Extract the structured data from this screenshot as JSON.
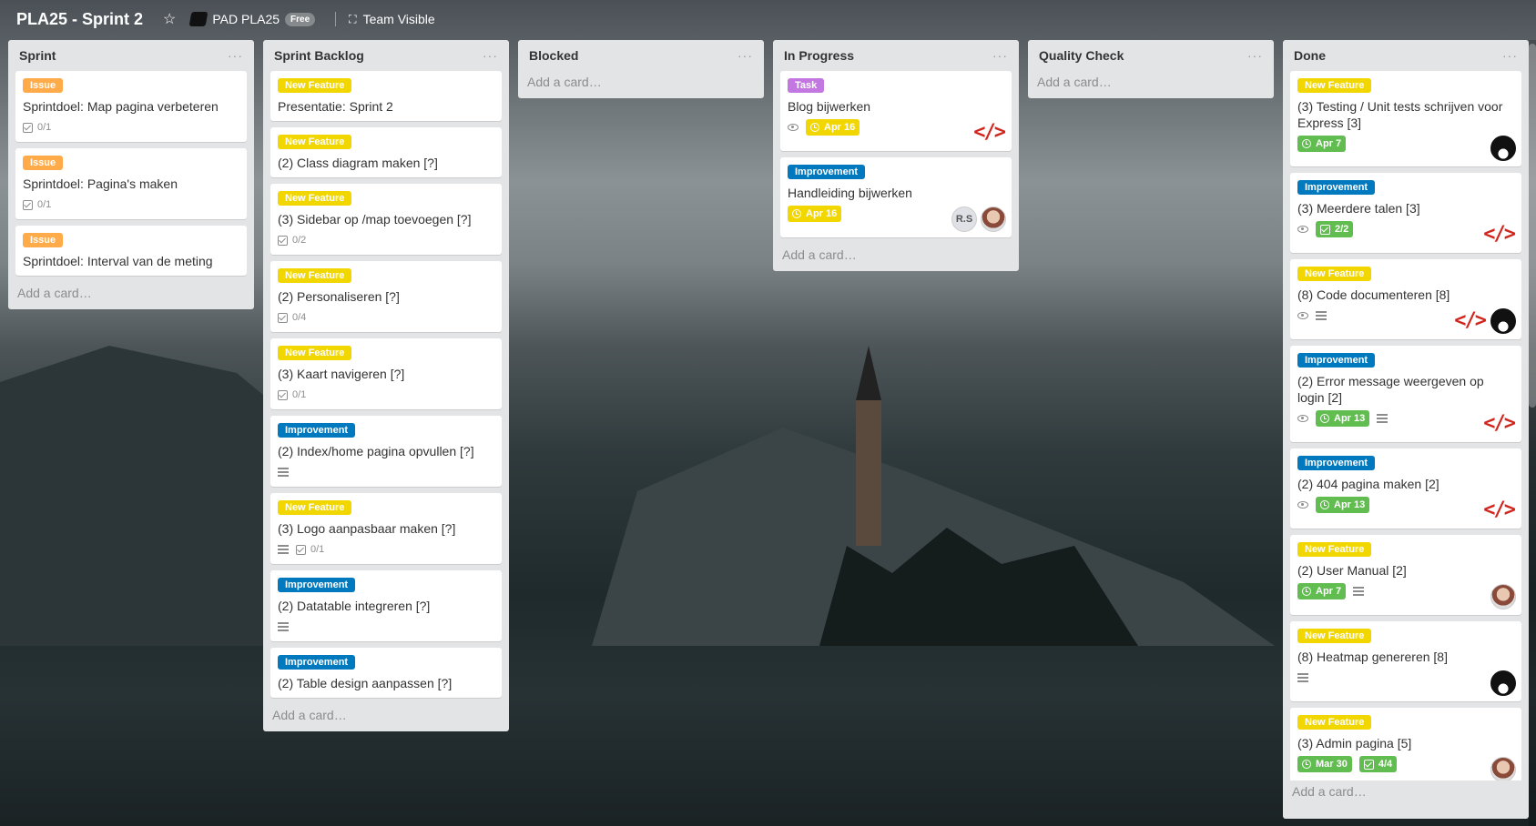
{
  "header": {
    "board_title": "PLA25 - Sprint 2",
    "org_name": "PAD PLA25",
    "org_badge": "Free",
    "visibility": "Team Visible"
  },
  "add_card_label": "Add a card…",
  "lists": [
    {
      "title": "Sprint",
      "cards": [
        {
          "label": "Issue",
          "title": "Sprintdoel: Map pagina verbeteren",
          "checklist": "0/1"
        },
        {
          "label": "Issue",
          "title": "Sprintdoel: Pagina's maken",
          "checklist": "0/1"
        },
        {
          "label": "Issue",
          "title": "Sprintdoel: Interval van de meting"
        }
      ]
    },
    {
      "title": "Sprint Backlog",
      "cards": [
        {
          "label": "New Feature",
          "title": "Presentatie: Sprint 2"
        },
        {
          "label": "New Feature",
          "title": "(2) Class diagram maken [?]"
        },
        {
          "label": "New Feature",
          "title": "(3) Sidebar op /map toevoegen [?]",
          "checklist": "0/2"
        },
        {
          "label": "New Feature",
          "title": "(2) Personaliseren [?]",
          "checklist": "0/4"
        },
        {
          "label": "New Feature",
          "title": "(3) Kaart navigeren [?]",
          "checklist": "0/1"
        },
        {
          "label": "Improvement",
          "title": "(2) Index/home pagina opvullen [?]"
        },
        {
          "label": "New Feature",
          "title": "(3) Logo aanpasbaar maken [?]",
          "checklist": "0/1"
        },
        {
          "label": "Improvement",
          "title": "(2) Datatable integreren [?]"
        },
        {
          "label": "Improvement",
          "title": "(2) Table design aanpassen [?]"
        }
      ]
    },
    {
      "title": "Blocked",
      "cards": []
    },
    {
      "title": "In Progress",
      "cards": [
        {
          "label": "Task",
          "title": "Blog bijwerken",
          "due": "Apr 16"
        },
        {
          "label": "Improvement",
          "title": "Handleiding bijwerken",
          "due": "Apr 16",
          "member_initials": "R.S"
        }
      ]
    },
    {
      "title": "Quality Check",
      "cards": []
    },
    {
      "title": "Done",
      "cards": [
        {
          "label": "New Feature",
          "title": "(3) Testing / Unit tests schrijven voor Express [3]",
          "due": "Apr 7"
        },
        {
          "label": "Improvement",
          "title": "(3) Meerdere talen [3]",
          "checklist": "2/2"
        },
        {
          "label": "New Feature",
          "title": "(8) Code documenteren [8]"
        },
        {
          "label": "Improvement",
          "title": "(2) Error message weergeven op login [2]",
          "due": "Apr 13"
        },
        {
          "label": "Improvement",
          "title": "(2) 404 pagina maken [2]",
          "due": "Apr 13"
        },
        {
          "label": "New Feature",
          "title": "(2) User Manual [2]",
          "due": "Apr 7"
        },
        {
          "label": "New Feature",
          "title": "(8) Heatmap genereren [8]"
        },
        {
          "label": "New Feature",
          "title": "(3) Admin pagina [5]",
          "due": "Mar 30",
          "checklist": "4/4"
        }
      ]
    }
  ]
}
